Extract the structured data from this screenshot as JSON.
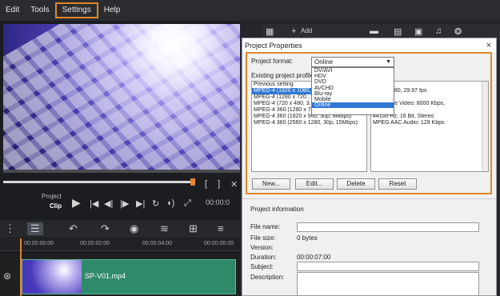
{
  "menu": {
    "items": [
      "Edit",
      "Tools",
      "Settings",
      "Help"
    ],
    "active": "Settings"
  },
  "preview": {
    "mode_project": "Project",
    "mode_clip": "Clip",
    "timecode": "00:00:0",
    "brackets": [
      "[",
      "]"
    ]
  },
  "timeline": {
    "ruler": [
      "00:00:00:00",
      "00:00:02:00",
      "00:00:04:00",
      "00:00:06:00"
    ],
    "clip_name": "SP-V01.mp4"
  },
  "library": {
    "add_label": "Add"
  },
  "dialog": {
    "title": "Project Properties",
    "close": "×",
    "project_format_label": "Project format:",
    "project_format_value": "Online",
    "format_options": [
      "DV/AVI",
      "HDV",
      "DVD",
      "AVCHD",
      "Blu-ray",
      "Mobile",
      "Online"
    ],
    "format_selected": "Online",
    "existing_profiles_label": "Existing project profiles:",
    "profiles": [
      "Previous setting",
      "MPEG-4 (1920 x 1080, ...",
      "MPEG-4 (1280 x 720...",
      "MPEG-4 (720 x 480, 3...",
      "MPEG-4 360 (1280 x 7...",
      "MPEG-4 360 (1920 x 960, 30p, 8Mbps)",
      "MPEG-4 360 (2560 x 1280, 30p, 15Mbps)"
    ],
    "profile_selected": 1,
    "info_lines": [
      "Files",
      "920 x 1080, 29.97 fps",
      "sed",
      "ain Profile Video: 8000 Kbps,",
      "",
      "44100 Hz, 16 Bit, Stereo",
      "MPEG AAC Audio: 128 Kbps"
    ],
    "buttons": {
      "new": "New...",
      "edit": "Edit...",
      "delete": "Delete",
      "reset": "Reset"
    },
    "project_info": {
      "title": "Project information",
      "file_name_label": "File name:",
      "file_size_label": "File size:",
      "file_size_value": "0 bytes",
      "version_label": "Version:",
      "duration_label": "Duration:",
      "duration_value": "00:00:07:00",
      "subject_label": "Subject:",
      "description_label": "Description:"
    }
  },
  "colors": {
    "accent": "#e0862c",
    "selection": "#3077d4",
    "clip": "#2f8a6a"
  }
}
